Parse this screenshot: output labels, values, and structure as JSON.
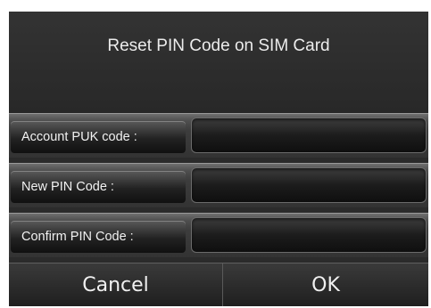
{
  "dialog": {
    "title": "Reset PIN Code on SIM Card"
  },
  "fields": [
    {
      "label": "Account PUK code :",
      "value": ""
    },
    {
      "label": "New PIN Code :",
      "value": ""
    },
    {
      "label": "Confirm PIN Code :",
      "value": ""
    }
  ],
  "buttons": {
    "cancel_label": "Cancel",
    "ok_label": "OK"
  }
}
